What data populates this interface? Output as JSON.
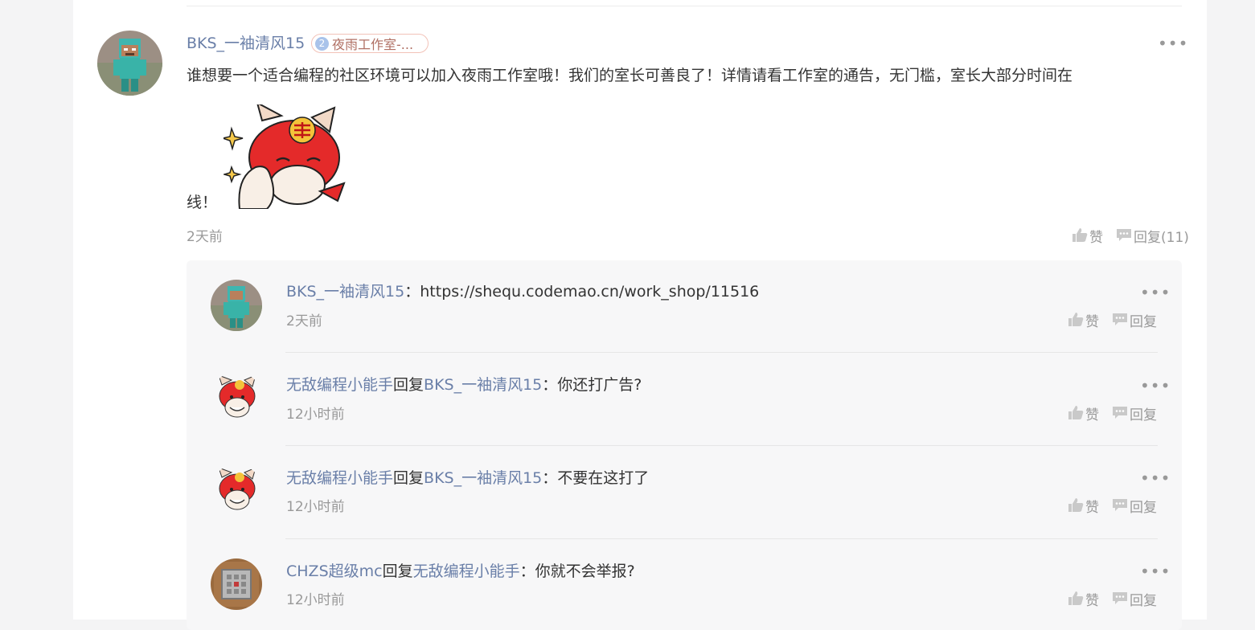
{
  "comment": {
    "author": "BKS_一袖清风15",
    "badge_number": "2",
    "badge_text": "夜雨工作室-...",
    "text_line1": "谁想要一个适合编程的社区环境可以加入夜雨工作室哦！我们的室长可善良了！详情请看工作室的通告，无门槛，室长大部分时间在",
    "text_line2": "线！",
    "time": "2天前",
    "like_label": "赞",
    "reply_label": "回复(11)",
    "more": "•••"
  },
  "replies": [
    {
      "author": "BKS_一袖清风15",
      "reply_word": "",
      "target": "",
      "colon": "：",
      "text": "https://shequ.codemao.cn/work_shop/11516",
      "time": "2天前",
      "like_label": "赞",
      "reply_label": "回复",
      "more": "•••",
      "avatar": "minecraft-steve"
    },
    {
      "author": "无敌编程小能手",
      "reply_word": "回复",
      "target": "BKS_一袖清风15",
      "colon": "：",
      "text": "你还打广告?",
      "time": "12小时前",
      "like_label": "赞",
      "reply_label": "回复",
      "more": "•••",
      "avatar": "red-cat"
    },
    {
      "author": "无敌编程小能手",
      "reply_word": "回复",
      "target": "BKS_一袖清风15",
      "colon": "：",
      "text": "不要在这打了",
      "time": "12小时前",
      "like_label": "赞",
      "reply_label": "回复",
      "more": "•••",
      "avatar": "red-cat"
    },
    {
      "author": "CHZS超级mc",
      "reply_word": "回复",
      "target": "无敌编程小能手",
      "colon": "：",
      "text": "你就不会举报?",
      "time": "12小时前",
      "like_label": "赞",
      "reply_label": "回复",
      "more": "•••",
      "avatar": "command-block"
    }
  ],
  "colors": {
    "link": "#6a7fa8",
    "muted": "#999999",
    "text": "#333333",
    "reply_bg": "#f7f7f8"
  }
}
